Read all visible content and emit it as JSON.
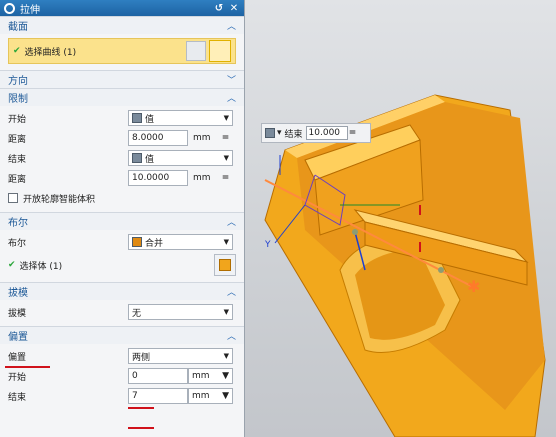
{
  "dialog": {
    "title": "拉伸"
  },
  "sections": {
    "section": {
      "title": "截面",
      "select_curve": "选择曲线 (1)"
    },
    "direction": {
      "title": "方向"
    },
    "limits": {
      "title": "限制",
      "start_label": "开始",
      "start_value": "值",
      "dist1_label": "距离",
      "dist1_value": "8.0000",
      "dist1_unit": "mm",
      "end_label": "结束",
      "end_value": "值",
      "dist2_label": "距离",
      "dist2_value": "10.0000",
      "dist2_unit": "mm",
      "open_profile": "开放轮廓智能体积"
    },
    "boolean": {
      "title": "布尔",
      "label": "布尔",
      "value": "合并",
      "select_body": "选择体 (1)"
    },
    "draft": {
      "title": "拔模",
      "label": "拔模",
      "value": "无"
    },
    "offset": {
      "title": "偏置",
      "type_label": "偏置",
      "type_value": "两侧",
      "start_label": "开始",
      "start_value": "0",
      "start_unit": "mm",
      "end_label": "结束",
      "end_value": "7",
      "end_unit": "mm"
    }
  },
  "float_bar": {
    "label": "结束",
    "value": "10.000",
    "eq": "="
  },
  "colors": {
    "accent": "#1f5a98",
    "highlight": "#fbe28c",
    "part": "#f2a81c",
    "annotation": "#d0121b"
  }
}
